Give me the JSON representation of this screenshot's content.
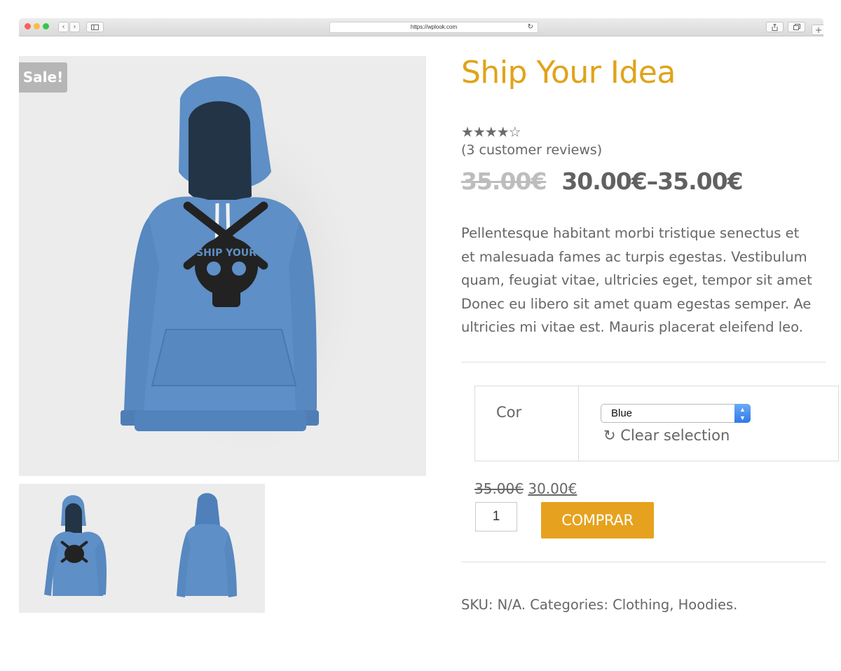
{
  "browser": {
    "url": "https://wplook.com",
    "back_glyph": "‹",
    "forward_glyph": "›",
    "reload_glyph": "↻"
  },
  "product": {
    "sale_badge": "Sale!",
    "title": "Ship Your Idea",
    "rating": {
      "filled": 4,
      "total": 5,
      "stars_text": "★★★★☆"
    },
    "reviews_text": "(3 customer reviews)",
    "price_old": "35.00€",
    "price_range": "30.00€–35.00€",
    "description_lines": [
      "Pellentesque habitant morbi tristique senectus et",
      "et malesuada fames ac turpis egestas. Vestibulum",
      "quam, feugiat vitae, ultricies eget, tempor sit amet",
      "Donec eu libero sit amet quam egestas semper. Ae",
      "ultricies mi vitae est. Mauris placerat eleifend leo."
    ],
    "variation": {
      "label": "Cor",
      "selected": "Blue",
      "clear_icon": "↻",
      "clear_text": "Clear selection"
    },
    "variation_price_old": "35.00€",
    "variation_price_new": "30.00€",
    "quantity": "1",
    "buy_label": "COMPRAR",
    "meta_text": "SKU: N/A. Categories: Clothing, Hoodies."
  },
  "colors": {
    "accent": "#e0a318",
    "button": "#e6a21e",
    "hoodie": "#5e8fc6"
  }
}
